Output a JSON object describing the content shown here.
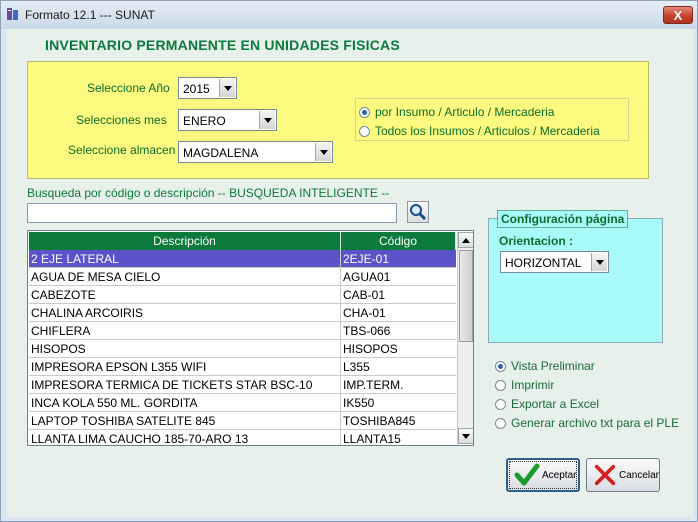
{
  "window": {
    "title": "Formato 12.1 --- SUNAT",
    "close_glyph": "X"
  },
  "heading": "INVENTARIO PERMANENTE EN UNIDADES FISICAS",
  "filters": {
    "year_label": "Seleccione Año",
    "year_value": "2015",
    "month_label": "Selecciones mes",
    "month_value": "ENERO",
    "warehouse_label": "Seleccione almacen",
    "warehouse_value": "MAGDALENA"
  },
  "scope_options": [
    {
      "label": "por Insumo / Articulo / Mercaderia",
      "selected": true
    },
    {
      "label": "Todos los Insumos / Articulos / Mercaderia",
      "selected": false
    }
  ],
  "search": {
    "label": "Busqueda por código o descripción -- BUSQUEDA INTELIGENTE --",
    "value": ""
  },
  "grid": {
    "columns": [
      "Descripción",
      "Código"
    ],
    "rows": [
      [
        "2 EJE LATERAL",
        "2EJE-01"
      ],
      [
        "AGUA DE MESA CIELO",
        "AGUA01"
      ],
      [
        "CABEZOTE",
        "CAB-01"
      ],
      [
        "CHALINA ARCOIRIS",
        "CHA-01"
      ],
      [
        "CHIFLERA",
        "TBS-066"
      ],
      [
        "HISOPOS",
        "HISOPOS"
      ],
      [
        "IMPRESORA EPSON L355 WIFI",
        "L355"
      ],
      [
        "IMPRESORA TERMICA DE TICKETS STAR BSC-10",
        "IMP.TERM."
      ],
      [
        "INCA KOLA 550 ML. GORDITA",
        "IK550"
      ],
      [
        "LAPTOP TOSHIBA SATELITE 845",
        "TOSHIBA845"
      ],
      [
        "LLANTA LIMA CAUCHO 185-70-ARO 13",
        "LLANTA15"
      ]
    ],
    "selected_row": 0
  },
  "config": {
    "title": "Configuración página",
    "orientation_label": "Orientacion :",
    "orientation_value": "HORIZONTAL"
  },
  "output_options": [
    {
      "label": "Vista Preliminar",
      "selected": true
    },
    {
      "label": "Imprimir",
      "selected": false
    },
    {
      "label": "Exportar a Excel",
      "selected": false
    },
    {
      "label": "Generar archivo txt para el PLE",
      "selected": false
    }
  ],
  "buttons": {
    "accept": "Aceptar",
    "cancel": "Cancelar"
  },
  "colors": {
    "accent_green": "#0c7a3a",
    "selection": "#5a53c9",
    "panel_yellow": "#fcfb80",
    "panel_cyan": "#a8fbf8"
  }
}
